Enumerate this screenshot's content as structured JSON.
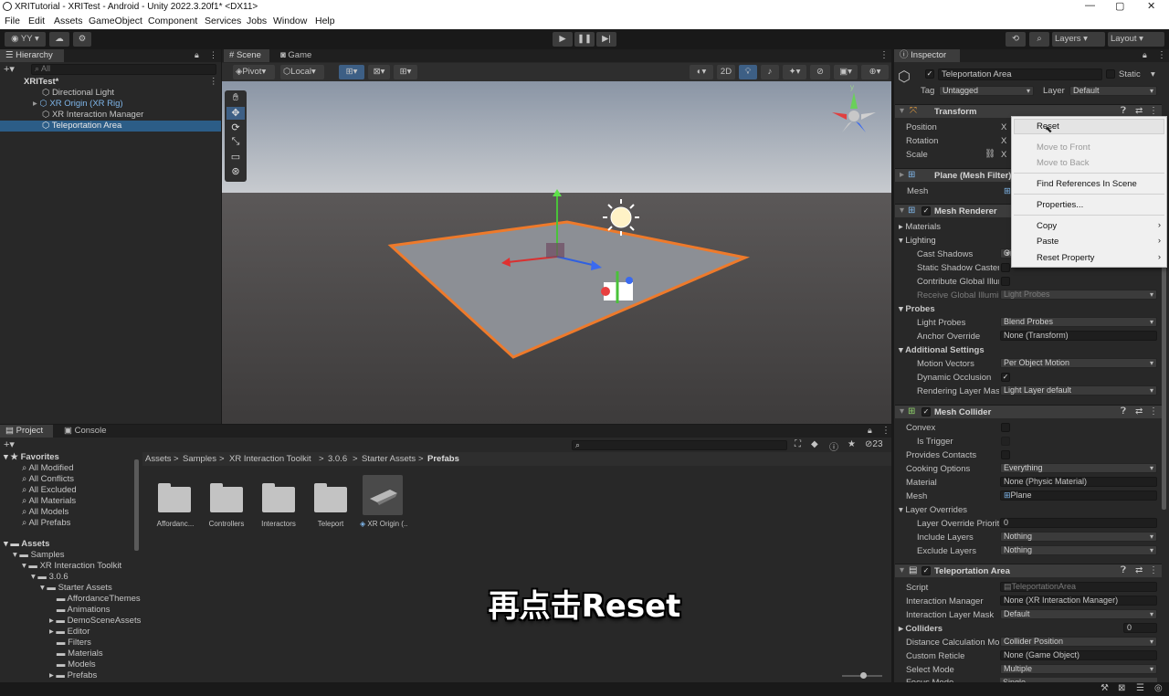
{
  "window": {
    "title": "XRITutorial - XRITest - Android - Unity 2022.3.20f1* <DX11>"
  },
  "menu": [
    "File",
    "Edit",
    "Assets",
    "GameObject",
    "Component",
    "Services",
    "Jobs",
    "Window",
    "Help"
  ],
  "toolbar": {
    "account": "YY",
    "layers": "Layers",
    "layout": "Layout"
  },
  "hierarchy": {
    "tab": "Hierarchy",
    "search_placeholder": "All",
    "scene": "XRITest*",
    "items": [
      "Directional Light",
      "XR Origin (XR Rig)",
      "XR Interaction Manager",
      "Teleportation Area"
    ]
  },
  "scene_view": {
    "tabs": [
      "Scene",
      "Game"
    ],
    "pivot": "Pivot",
    "local": "Local",
    "mode_2d": "2D"
  },
  "project": {
    "tabs": [
      "Project",
      "Console"
    ],
    "favorites_label": "Favorites",
    "favorites": [
      "All Modified",
      "All Conflicts",
      "All Excluded",
      "All Materials",
      "All Models",
      "All Prefabs"
    ],
    "assets_label": "Assets",
    "tree": [
      "Samples",
      "XR Interaction Toolkit",
      "3.0.6",
      "Starter Assets",
      "AffordanceThemes",
      "Animations",
      "DemoSceneAssets",
      "Editor",
      "Filters",
      "Materials",
      "Models",
      "Prefabs"
    ],
    "breadcrumb": [
      "Assets",
      "Samples",
      "XR Interaction Toolkit",
      "3.0.6",
      "Starter Assets",
      "Prefabs"
    ],
    "grid": [
      "Affordanc...",
      "Controllers",
      "Interactors",
      "Teleport",
      "XR Origin (..."
    ],
    "hidden_count": "23"
  },
  "inspector": {
    "tab": "Inspector",
    "object_name": "Teleportation Area",
    "static_label": "Static",
    "tag_label": "Tag",
    "tag_value": "Untagged",
    "layer_label": "Layer",
    "layer_value": "Default",
    "transform": {
      "title": "Transform",
      "position": "Position",
      "rotation": "Rotation",
      "scale": "Scale",
      "axis": "X"
    },
    "mesh_filter": {
      "title": "Plane (Mesh Filter)",
      "mesh": "Mesh"
    },
    "mesh_renderer": {
      "title": "Mesh Renderer",
      "materials": "Materials",
      "lighting": "Lighting",
      "cast_shadows": "Cast Shadows",
      "cast_shadows_value": "On",
      "static_shadow": "Static Shadow Caster",
      "contribute_gi": "Contribute Global Illumination",
      "receive_gi": "Receive Global Illumination",
      "receive_gi_value": "Light Probes",
      "probes": "Probes",
      "light_probes": "Light Probes",
      "light_probes_value": "Blend Probes",
      "anchor_override": "Anchor Override",
      "anchor_override_value": "None (Transform)",
      "additional": "Additional Settings",
      "motion_vectors": "Motion Vectors",
      "motion_vectors_value": "Per Object Motion",
      "dynamic_occlusion": "Dynamic Occlusion",
      "rendering_layer": "Rendering Layer Mask",
      "rendering_layer_value": "Light Layer default"
    },
    "mesh_collider": {
      "title": "Mesh Collider",
      "convex": "Convex",
      "is_trigger": "Is Trigger",
      "provides_contacts": "Provides Contacts",
      "cooking_options": "Cooking Options",
      "cooking_value": "Everything",
      "material": "Material",
      "material_value": "None (Physic Material)",
      "mesh": "Mesh",
      "mesh_value": "Plane",
      "layer_overrides": "Layer Overrides",
      "layer_override_priority": "Layer Override Priority",
      "layer_override_priority_value": "0",
      "include_layers": "Include Layers",
      "include_value": "Nothing",
      "exclude_layers": "Exclude Layers",
      "exclude_value": "Nothing"
    },
    "teleportation_area": {
      "title": "Teleportation Area",
      "script": "Script",
      "script_value": "TeleportationArea",
      "interaction_manager": "Interaction Manager",
      "interaction_manager_value": "None (XR Interaction Manager)",
      "interaction_layer_mask": "Interaction Layer Mask",
      "interaction_layer_mask_value": "Default",
      "colliders": "Colliders",
      "colliders_value": "0",
      "distance_calc": "Distance Calculation Mode",
      "distance_calc_value": "Collider Position",
      "custom_reticle": "Custom Reticle",
      "custom_reticle_value": "None (Game Object)",
      "select_mode": "Select Mode",
      "select_mode_value": "Multiple",
      "focus_mode": "Focus Mode",
      "focus_mode_value": "Single"
    }
  },
  "context_menu": {
    "reset": "Reset",
    "move_front": "Move to Front",
    "move_back": "Move to Back",
    "find_refs": "Find References In Scene",
    "properties": "Properties...",
    "copy": "Copy",
    "paste": "Paste",
    "reset_property": "Reset Property"
  },
  "subtitle": "再点击Reset",
  "colors": {
    "selection": "#2c5d87",
    "accent_blue": "#7fb6ea",
    "plane_outline": "#f07a2a"
  }
}
